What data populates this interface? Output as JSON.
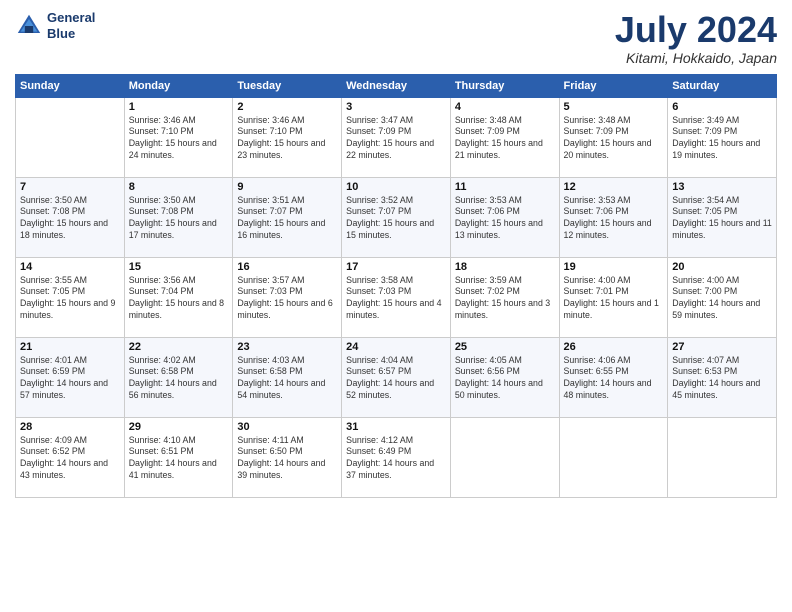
{
  "header": {
    "logo_line1": "General",
    "logo_line2": "Blue",
    "month": "July 2024",
    "location": "Kitami, Hokkaido, Japan"
  },
  "days_of_week": [
    "Sunday",
    "Monday",
    "Tuesday",
    "Wednesday",
    "Thursday",
    "Friday",
    "Saturday"
  ],
  "weeks": [
    [
      {
        "day": "",
        "sunrise": "",
        "sunset": "",
        "daylight": ""
      },
      {
        "day": "1",
        "sunrise": "Sunrise: 3:46 AM",
        "sunset": "Sunset: 7:10 PM",
        "daylight": "Daylight: 15 hours and 24 minutes."
      },
      {
        "day": "2",
        "sunrise": "Sunrise: 3:46 AM",
        "sunset": "Sunset: 7:10 PM",
        "daylight": "Daylight: 15 hours and 23 minutes."
      },
      {
        "day": "3",
        "sunrise": "Sunrise: 3:47 AM",
        "sunset": "Sunset: 7:09 PM",
        "daylight": "Daylight: 15 hours and 22 minutes."
      },
      {
        "day": "4",
        "sunrise": "Sunrise: 3:48 AM",
        "sunset": "Sunset: 7:09 PM",
        "daylight": "Daylight: 15 hours and 21 minutes."
      },
      {
        "day": "5",
        "sunrise": "Sunrise: 3:48 AM",
        "sunset": "Sunset: 7:09 PM",
        "daylight": "Daylight: 15 hours and 20 minutes."
      },
      {
        "day": "6",
        "sunrise": "Sunrise: 3:49 AM",
        "sunset": "Sunset: 7:09 PM",
        "daylight": "Daylight: 15 hours and 19 minutes."
      }
    ],
    [
      {
        "day": "7",
        "sunrise": "Sunrise: 3:50 AM",
        "sunset": "Sunset: 7:08 PM",
        "daylight": "Daylight: 15 hours and 18 minutes."
      },
      {
        "day": "8",
        "sunrise": "Sunrise: 3:50 AM",
        "sunset": "Sunset: 7:08 PM",
        "daylight": "Daylight: 15 hours and 17 minutes."
      },
      {
        "day": "9",
        "sunrise": "Sunrise: 3:51 AM",
        "sunset": "Sunset: 7:07 PM",
        "daylight": "Daylight: 15 hours and 16 minutes."
      },
      {
        "day": "10",
        "sunrise": "Sunrise: 3:52 AM",
        "sunset": "Sunset: 7:07 PM",
        "daylight": "Daylight: 15 hours and 15 minutes."
      },
      {
        "day": "11",
        "sunrise": "Sunrise: 3:53 AM",
        "sunset": "Sunset: 7:06 PM",
        "daylight": "Daylight: 15 hours and 13 minutes."
      },
      {
        "day": "12",
        "sunrise": "Sunrise: 3:53 AM",
        "sunset": "Sunset: 7:06 PM",
        "daylight": "Daylight: 15 hours and 12 minutes."
      },
      {
        "day": "13",
        "sunrise": "Sunrise: 3:54 AM",
        "sunset": "Sunset: 7:05 PM",
        "daylight": "Daylight: 15 hours and 11 minutes."
      }
    ],
    [
      {
        "day": "14",
        "sunrise": "Sunrise: 3:55 AM",
        "sunset": "Sunset: 7:05 PM",
        "daylight": "Daylight: 15 hours and 9 minutes."
      },
      {
        "day": "15",
        "sunrise": "Sunrise: 3:56 AM",
        "sunset": "Sunset: 7:04 PM",
        "daylight": "Daylight: 15 hours and 8 minutes."
      },
      {
        "day": "16",
        "sunrise": "Sunrise: 3:57 AM",
        "sunset": "Sunset: 7:03 PM",
        "daylight": "Daylight: 15 hours and 6 minutes."
      },
      {
        "day": "17",
        "sunrise": "Sunrise: 3:58 AM",
        "sunset": "Sunset: 7:03 PM",
        "daylight": "Daylight: 15 hours and 4 minutes."
      },
      {
        "day": "18",
        "sunrise": "Sunrise: 3:59 AM",
        "sunset": "Sunset: 7:02 PM",
        "daylight": "Daylight: 15 hours and 3 minutes."
      },
      {
        "day": "19",
        "sunrise": "Sunrise: 4:00 AM",
        "sunset": "Sunset: 7:01 PM",
        "daylight": "Daylight: 15 hours and 1 minute."
      },
      {
        "day": "20",
        "sunrise": "Sunrise: 4:00 AM",
        "sunset": "Sunset: 7:00 PM",
        "daylight": "Daylight: 14 hours and 59 minutes."
      }
    ],
    [
      {
        "day": "21",
        "sunrise": "Sunrise: 4:01 AM",
        "sunset": "Sunset: 6:59 PM",
        "daylight": "Daylight: 14 hours and 57 minutes."
      },
      {
        "day": "22",
        "sunrise": "Sunrise: 4:02 AM",
        "sunset": "Sunset: 6:58 PM",
        "daylight": "Daylight: 14 hours and 56 minutes."
      },
      {
        "day": "23",
        "sunrise": "Sunrise: 4:03 AM",
        "sunset": "Sunset: 6:58 PM",
        "daylight": "Daylight: 14 hours and 54 minutes."
      },
      {
        "day": "24",
        "sunrise": "Sunrise: 4:04 AM",
        "sunset": "Sunset: 6:57 PM",
        "daylight": "Daylight: 14 hours and 52 minutes."
      },
      {
        "day": "25",
        "sunrise": "Sunrise: 4:05 AM",
        "sunset": "Sunset: 6:56 PM",
        "daylight": "Daylight: 14 hours and 50 minutes."
      },
      {
        "day": "26",
        "sunrise": "Sunrise: 4:06 AM",
        "sunset": "Sunset: 6:55 PM",
        "daylight": "Daylight: 14 hours and 48 minutes."
      },
      {
        "day": "27",
        "sunrise": "Sunrise: 4:07 AM",
        "sunset": "Sunset: 6:53 PM",
        "daylight": "Daylight: 14 hours and 45 minutes."
      }
    ],
    [
      {
        "day": "28",
        "sunrise": "Sunrise: 4:09 AM",
        "sunset": "Sunset: 6:52 PM",
        "daylight": "Daylight: 14 hours and 43 minutes."
      },
      {
        "day": "29",
        "sunrise": "Sunrise: 4:10 AM",
        "sunset": "Sunset: 6:51 PM",
        "daylight": "Daylight: 14 hours and 41 minutes."
      },
      {
        "day": "30",
        "sunrise": "Sunrise: 4:11 AM",
        "sunset": "Sunset: 6:50 PM",
        "daylight": "Daylight: 14 hours and 39 minutes."
      },
      {
        "day": "31",
        "sunrise": "Sunrise: 4:12 AM",
        "sunset": "Sunset: 6:49 PM",
        "daylight": "Daylight: 14 hours and 37 minutes."
      },
      {
        "day": "",
        "sunrise": "",
        "sunset": "",
        "daylight": ""
      },
      {
        "day": "",
        "sunrise": "",
        "sunset": "",
        "daylight": ""
      },
      {
        "day": "",
        "sunrise": "",
        "sunset": "",
        "daylight": ""
      }
    ]
  ]
}
